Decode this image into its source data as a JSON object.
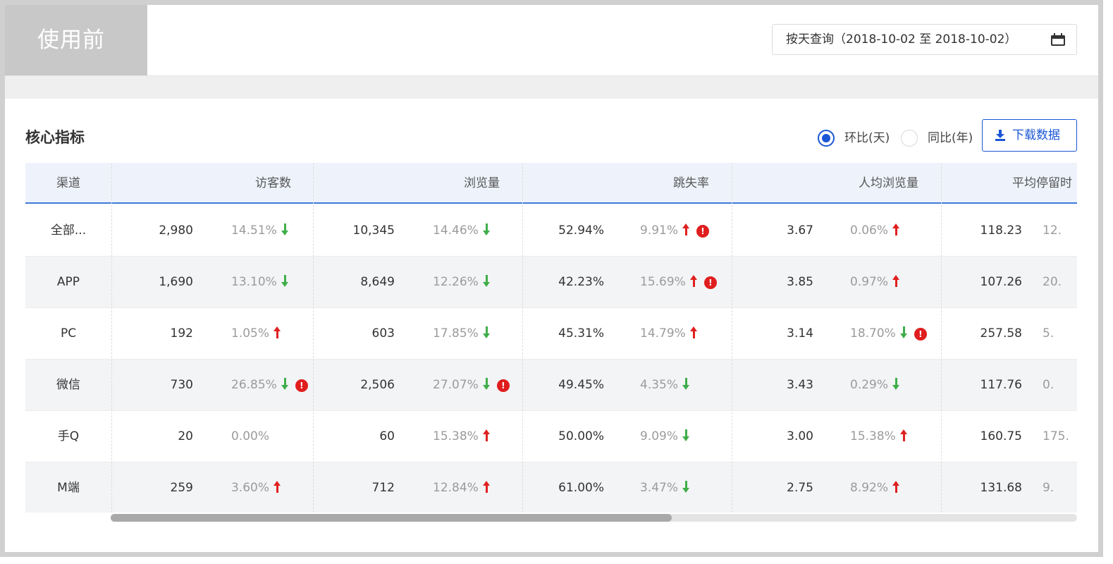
{
  "header": {
    "badge": "使用前",
    "date_query": "按天查询（2018-10-02 至 2018-10-02）",
    "calendar_icon": "calendar-icon"
  },
  "section": {
    "title": "核心指标",
    "compare_options": [
      {
        "label": "环比(天)",
        "selected": true
      },
      {
        "label": "同比(年)",
        "selected": false
      }
    ],
    "download_label": "下载数据"
  },
  "colors": {
    "accent": "#1a56d6",
    "up": "#e02020",
    "down": "#3fae49",
    "alert": "#e01e1e"
  },
  "table": {
    "columns": [
      "渠道",
      "访客数",
      "浏览量",
      "跳失率",
      "人均浏览量",
      "平均停留时"
    ],
    "rows": [
      {
        "channel": "全部...",
        "visitors": "2,980",
        "visitors_chg": "14.51%",
        "visitors_dir": "down",
        "visitors_alert": false,
        "pv": "10,345",
        "pv_chg": "14.46%",
        "pv_dir": "down",
        "pv_alert": false,
        "bounce": "52.94%",
        "bounce_chg": "9.91%",
        "bounce_dir": "up",
        "bounce_alert": true,
        "avgpv": "3.67",
        "avgpv_chg": "0.06%",
        "avgpv_dir": "up",
        "avgpv_alert": false,
        "stay": "118.23",
        "stay_chg": "12."
      },
      {
        "channel": "APP",
        "visitors": "1,690",
        "visitors_chg": "13.10%",
        "visitors_dir": "down",
        "visitors_alert": false,
        "pv": "8,649",
        "pv_chg": "12.26%",
        "pv_dir": "down",
        "pv_alert": false,
        "bounce": "42.23%",
        "bounce_chg": "15.69%",
        "bounce_dir": "up",
        "bounce_alert": true,
        "avgpv": "3.85",
        "avgpv_chg": "0.97%",
        "avgpv_dir": "up",
        "avgpv_alert": false,
        "stay": "107.26",
        "stay_chg": "20."
      },
      {
        "channel": "PC",
        "visitors": "192",
        "visitors_chg": "1.05%",
        "visitors_dir": "up",
        "visitors_alert": false,
        "pv": "603",
        "pv_chg": "17.85%",
        "pv_dir": "down",
        "pv_alert": false,
        "bounce": "45.31%",
        "bounce_chg": "14.79%",
        "bounce_dir": "up",
        "bounce_alert": false,
        "avgpv": "3.14",
        "avgpv_chg": "18.70%",
        "avgpv_dir": "down",
        "avgpv_alert": true,
        "stay": "257.58",
        "stay_chg": "5."
      },
      {
        "channel": "微信",
        "visitors": "730",
        "visitors_chg": "26.85%",
        "visitors_dir": "down",
        "visitors_alert": true,
        "pv": "2,506",
        "pv_chg": "27.07%",
        "pv_dir": "down",
        "pv_alert": true,
        "bounce": "49.45%",
        "bounce_chg": "4.35%",
        "bounce_dir": "down",
        "bounce_alert": false,
        "avgpv": "3.43",
        "avgpv_chg": "0.29%",
        "avgpv_dir": "down",
        "avgpv_alert": false,
        "stay": "117.76",
        "stay_chg": "0."
      },
      {
        "channel": "手Q",
        "visitors": "20",
        "visitors_chg": "0.00%",
        "visitors_dir": "",
        "visitors_alert": false,
        "pv": "60",
        "pv_chg": "15.38%",
        "pv_dir": "up",
        "pv_alert": false,
        "bounce": "50.00%",
        "bounce_chg": "9.09%",
        "bounce_dir": "down",
        "bounce_alert": false,
        "avgpv": "3.00",
        "avgpv_chg": "15.38%",
        "avgpv_dir": "up",
        "avgpv_alert": false,
        "stay": "160.75",
        "stay_chg": "175."
      },
      {
        "channel": "M端",
        "visitors": "259",
        "visitors_chg": "3.60%",
        "visitors_dir": "up",
        "visitors_alert": false,
        "pv": "712",
        "pv_chg": "12.84%",
        "pv_dir": "up",
        "pv_alert": false,
        "bounce": "61.00%",
        "bounce_chg": "3.47%",
        "bounce_dir": "down",
        "bounce_alert": false,
        "avgpv": "2.75",
        "avgpv_chg": "8.92%",
        "avgpv_dir": "up",
        "avgpv_alert": false,
        "stay": "131.68",
        "stay_chg": "9."
      }
    ],
    "horizontal_scroll_position": 0.0
  }
}
